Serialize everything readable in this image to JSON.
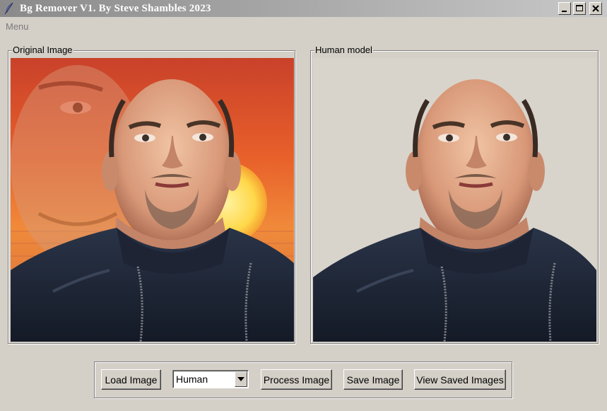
{
  "window": {
    "title": "Bg Remover V1. By Steve Shambles 2023"
  },
  "menu": {
    "items": [
      {
        "label": "Menu"
      }
    ]
  },
  "panels": {
    "left": {
      "label": "Original Image"
    },
    "right": {
      "label": "Human model"
    }
  },
  "toolbar": {
    "load_label": "Load Image",
    "model_select": {
      "value": "Human"
    },
    "process_label": "Process Image",
    "save_label": "Save Image",
    "view_label": "View Saved Images"
  },
  "icons": {
    "title": "feather-icon",
    "minimize": "minimize-icon",
    "maximize": "maximize-icon",
    "close": "close-icon",
    "dropdown": "chevron-down-icon"
  },
  "colors": {
    "window_bg": "#d4d0c8",
    "titlebar_start": "#8a8a8a",
    "titlebar_end": "#c8c8c8",
    "sunset_orange": "#e8602a",
    "sun_yellow": "#ffe060",
    "removed_bg": "#d8d4cc"
  }
}
